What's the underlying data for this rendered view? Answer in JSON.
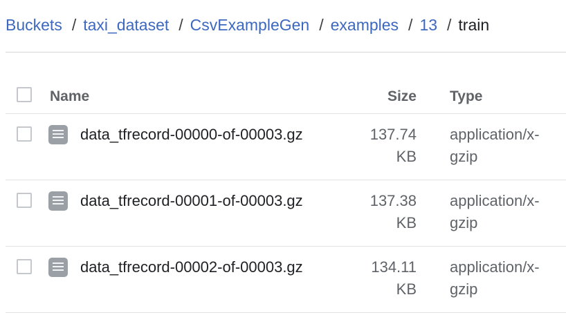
{
  "breadcrumb": {
    "items": [
      "Buckets",
      "taxi_dataset",
      "CsvExampleGen",
      "examples",
      "13"
    ],
    "current": "train",
    "separator": "/"
  },
  "table": {
    "headers": {
      "name": "Name",
      "size": "Size",
      "type": "Type"
    },
    "rows": [
      {
        "name": "data_tfrecord-00000-of-00003.gz",
        "size_value": "137.74",
        "size_unit": "KB",
        "type_line1": "application/x-",
        "type_line2": "gzip",
        "icon": "file-icon"
      },
      {
        "name": "data_tfrecord-00001-of-00003.gz",
        "size_value": "137.38",
        "size_unit": "KB",
        "type_line1": "application/x-",
        "type_line2": "gzip",
        "icon": "file-icon"
      },
      {
        "name": "data_tfrecord-00002-of-00003.gz",
        "size_value": "134.11",
        "size_unit": "KB",
        "type_line1": "application/x-",
        "type_line2": "gzip",
        "icon": "file-icon"
      }
    ]
  },
  "colors": {
    "link": "#3c68c0",
    "text": "#202124",
    "muted": "#5f6368",
    "icon": "#9aa0a6"
  }
}
